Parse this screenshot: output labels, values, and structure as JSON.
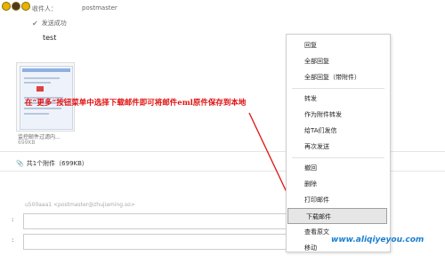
{
  "header": {
    "recipient_label": "收件人：",
    "recipient_name": "postmaster",
    "sent_status": "发送成功"
  },
  "message": {
    "body": "test"
  },
  "attachment": {
    "name": "监控邮件过滤内...",
    "size": "699KB",
    "summary": "共1个附件（699KB）"
  },
  "reply_area": {
    "from_line": "u500aaa1 <postmaster@zhujiaming.so>"
  },
  "annotation": {
    "text": "在“更多”按钮菜单中选择下载邮件即可将邮件eml原件保存到本地",
    "color": "#e01010"
  },
  "context_menu": {
    "items": [
      {
        "label": "回复"
      },
      {
        "label": "全部回复"
      },
      {
        "label": "全部回复（带附件）"
      },
      {
        "label": "转发"
      },
      {
        "label": "作为附件转发"
      },
      {
        "label": "给TA们发信"
      },
      {
        "label": "再次发送"
      },
      {
        "label": "撤回"
      },
      {
        "label": "删除"
      },
      {
        "label": "打印邮件"
      },
      {
        "label": "下载邮件"
      },
      {
        "label": "查看原文"
      },
      {
        "label": "移动"
      }
    ],
    "selected": "下载邮件"
  },
  "watermark": {
    "text": "www.aliqiyeyou.com",
    "color": "#1a7fd0"
  }
}
